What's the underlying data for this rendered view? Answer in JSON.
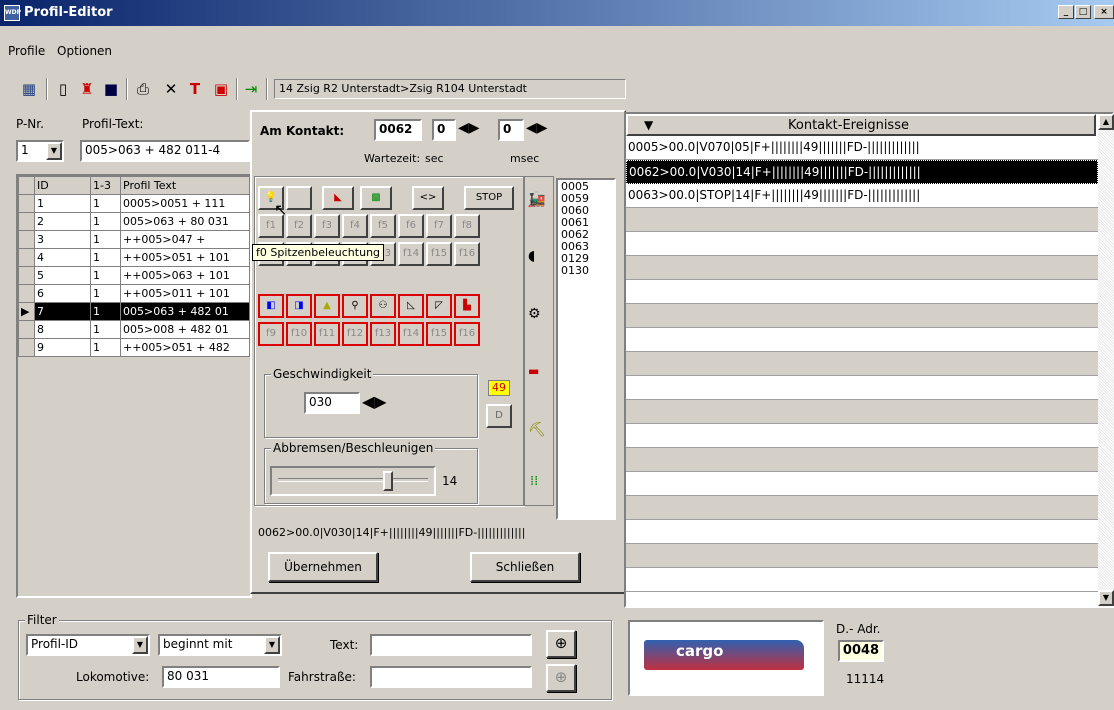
{
  "window": {
    "title": "Profil-Editor",
    "icon_text": "WDP",
    "min": "_",
    "max": "□",
    "close": "×"
  },
  "menu": {
    "profile": "Profile",
    "optionen": "Optionen"
  },
  "toolbar": {
    "route": "14 Zsig R2 Unterstadt>Zsig R104 Unterstadt",
    "icons": [
      "tree-icon",
      "new-doc-icon",
      "open-icon",
      "save-icon",
      "print-icon",
      "delete-icon",
      "tool-icon",
      "alert-icon",
      "exit-icon"
    ]
  },
  "left": {
    "pnr_label": "P-Nr.",
    "pnr_value": "1",
    "profiltext_label": "Profil-Text:",
    "profiltext_value": "005>063 + 482 011-4",
    "headers": [
      "ID",
      "1-3",
      "Profil Text"
    ],
    "rows": [
      {
        "id": "1",
        "c": "1",
        "text": "0005>0051 + 111"
      },
      {
        "id": "2",
        "c": "1",
        "text": "005>063 + 80 031"
      },
      {
        "id": "3",
        "c": "1",
        "text": "++005>047 +"
      },
      {
        "id": "4",
        "c": "1",
        "text": "++005>051 + 101"
      },
      {
        "id": "5",
        "c": "1",
        "text": "++005>063 + 101"
      },
      {
        "id": "6",
        "c": "1",
        "text": "++005>011 + 101"
      },
      {
        "id": "7",
        "c": "1",
        "text": "005>063 + 482 01"
      },
      {
        "id": "8",
        "c": "1",
        "text": "005>008 + 482 01"
      },
      {
        "id": "9",
        "c": "1",
        "text": "++005>051 + 482"
      }
    ]
  },
  "dialog": {
    "am_kontakt": "Am Kontakt:",
    "kontakt_value": "0062",
    "wait_sec": "0",
    "wait_msec": "0",
    "wartezeit": "Wartezeit:",
    "sec": "sec",
    "msec": "msec",
    "top_btns": {
      "arrows": "<>",
      "stop": "STOP"
    },
    "row2": [
      "f1",
      "f2",
      "f3",
      "f4",
      "f5",
      "f6",
      "f7",
      "f8"
    ],
    "row3": [
      "f9",
      "f10",
      "f11",
      "f12",
      "f13",
      "f14",
      "f15",
      "f16"
    ],
    "row5": [
      "f9",
      "f10",
      "f11",
      "f12",
      "f13",
      "f14",
      "f15",
      "f16"
    ],
    "tooltip": "f0 Spitzenbeleuchtung",
    "contacts": [
      "0005",
      "0059",
      "0060",
      "0061",
      "0062",
      "0063",
      "0129",
      "0130"
    ],
    "speed_label": "Geschwindigkeit",
    "speed_value": "030",
    "speed_badge": "49",
    "brake_label": "Abbremsen/Beschleunigen",
    "brake_value": "14",
    "slider_level": 0.75,
    "status": "0062>00.0|V030|14|F+||||||||49|||||||FD-|||||||||||||",
    "ok_btn": "Übernehmen",
    "close_btn": "Schließen"
  },
  "right": {
    "header": "Kontakt-Ereignisse",
    "events": [
      "0005>00.0|V070|05|F+||||||||49|||||||FD-|||||||||||||",
      "0062>00.0|V030|14|F+||||||||49|||||||FD-|||||||||||||",
      "0063>00.0|STOP|14|F+||||||||49|||||||FD-|||||||||||||"
    ]
  },
  "filter": {
    "title": "Filter",
    "field": "Profil-ID",
    "mode": "beginnt mit",
    "text_label": "Text:",
    "loco_label": "Lokomotive:",
    "loco_value": "80 031",
    "fahr_label": "Fahrstraße:"
  },
  "loco": {
    "brand": "cargo",
    "dadr_label": "D.- Adr.",
    "dadr_value": "0048",
    "number": "11114"
  }
}
